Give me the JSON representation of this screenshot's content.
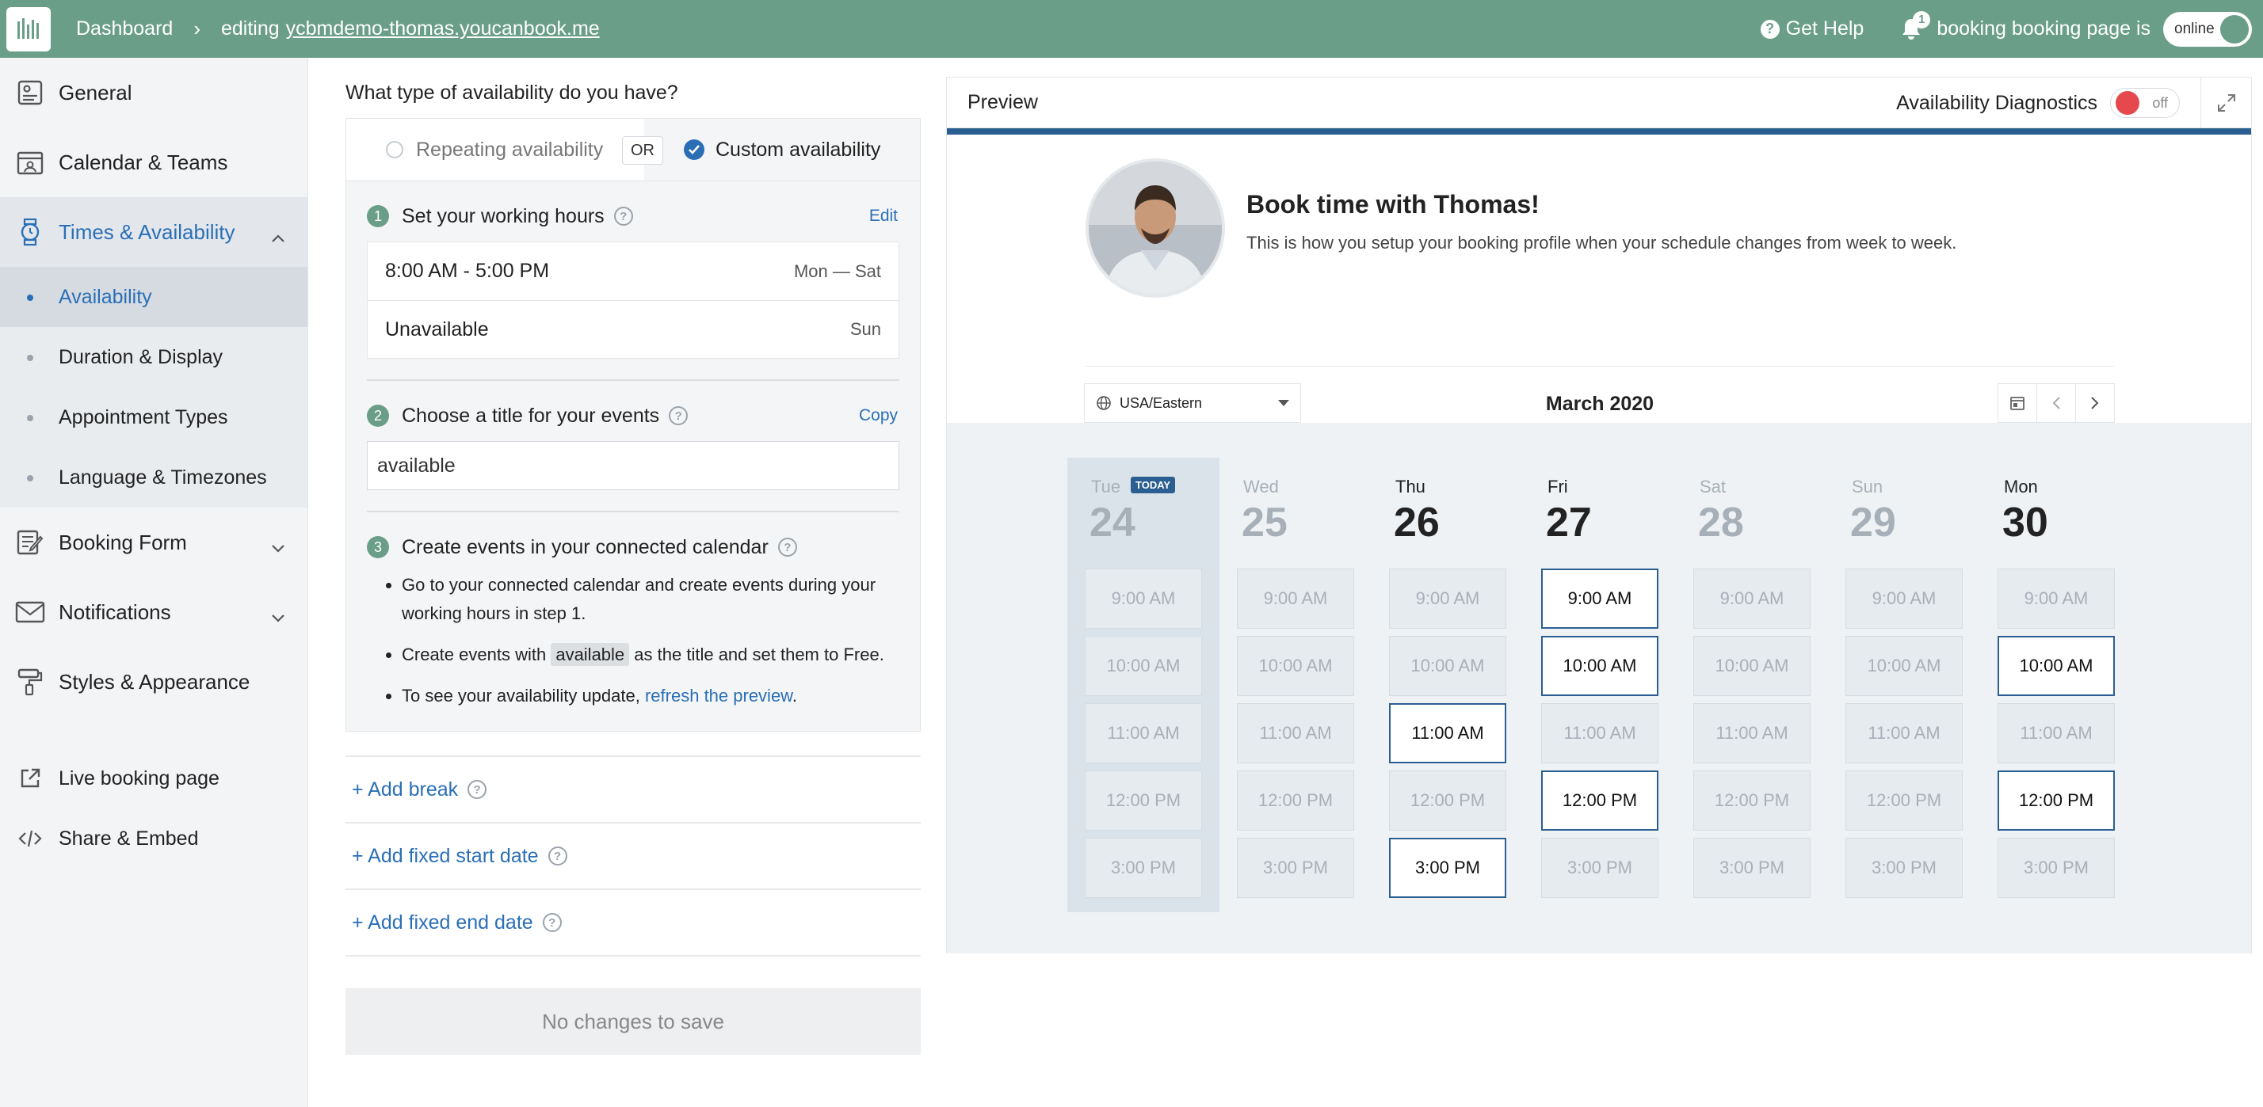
{
  "topbar": {
    "dashboard": "Dashboard",
    "editing_prefix": "editing",
    "editing_link": "ycbmdemo-thomas.youcanbook.me",
    "get_help": "Get Help",
    "notif_count": "1",
    "status_text": "booking booking page is",
    "online_label": "online"
  },
  "sidebar": {
    "general": "General",
    "calendar_teams": "Calendar & Teams",
    "times_availability": "Times & Availability",
    "sub": {
      "availability": "Availability",
      "duration_display": "Duration & Display",
      "appointment_types": "Appointment Types",
      "language_timezones": "Language & Timezones"
    },
    "booking_form": "Booking Form",
    "notifications": "Notifications",
    "styles_appearance": "Styles & Appearance",
    "live_booking_page": "Live booking page",
    "share_embed": "Share & Embed"
  },
  "availability": {
    "question": "What type of availability do you have?",
    "repeating": "Repeating availability",
    "or": "OR",
    "custom": "Custom availability",
    "step1": {
      "num": "1",
      "title": "Set your working hours",
      "action": "Edit",
      "rows": [
        {
          "hours": "8:00 AM - 5:00 PM",
          "days": "Mon — Sat"
        },
        {
          "hours": "Unavailable",
          "days": "Sun"
        }
      ]
    },
    "step2": {
      "num": "2",
      "title": "Choose a title for your events",
      "action": "Copy",
      "value": "available"
    },
    "step3": {
      "num": "3",
      "title": "Create events in your connected calendar",
      "b1": "Go to your connected calendar and create events during your working hours in step 1.",
      "b2_pre": "Create events with",
      "b2_kw": "available",
      "b2_mid": "as the title and set them to",
      "b2_free": "Free",
      "b2_end": ".",
      "b3_pre": "To see your availability update,",
      "b3_link": "refresh the preview",
      "b3_end": "."
    },
    "add_break": "+ Add break",
    "add_start": "+ Add fixed start date",
    "add_end": "+ Add fixed end date",
    "save": "No changes to save"
  },
  "preview": {
    "label": "Preview",
    "diagnostics": "Availability Diagnostics",
    "diag_state": "off",
    "book_title": "Book time with Thomas!",
    "book_sub": "This is how you setup your booking profile when your schedule changes from week to week.",
    "timezone": "USA/Eastern",
    "month": "March 2020",
    "today_label": "TODAY",
    "days": [
      {
        "dow": "Tue",
        "num": "24",
        "today": true,
        "off": true,
        "slots": [
          {
            "t": "9:00 AM",
            "on": false
          },
          {
            "t": "10:00 AM",
            "on": false
          },
          {
            "t": "11:00 AM",
            "on": false
          },
          {
            "t": "12:00 PM",
            "on": false
          },
          {
            "t": "3:00 PM",
            "on": false
          }
        ]
      },
      {
        "dow": "Wed",
        "num": "25",
        "off": true,
        "slots": [
          {
            "t": "9:00 AM",
            "on": false
          },
          {
            "t": "10:00 AM",
            "on": false
          },
          {
            "t": "11:00 AM",
            "on": false
          },
          {
            "t": "12:00 PM",
            "on": false
          },
          {
            "t": "3:00 PM",
            "on": false
          }
        ]
      },
      {
        "dow": "Thu",
        "num": "26",
        "off": false,
        "slots": [
          {
            "t": "9:00 AM",
            "on": false
          },
          {
            "t": "10:00 AM",
            "on": false
          },
          {
            "t": "11:00 AM",
            "on": true
          },
          {
            "t": "12:00 PM",
            "on": false
          },
          {
            "t": "3:00 PM",
            "on": true
          }
        ]
      },
      {
        "dow": "Fri",
        "num": "27",
        "off": false,
        "slots": [
          {
            "t": "9:00 AM",
            "on": true
          },
          {
            "t": "10:00 AM",
            "on": true
          },
          {
            "t": "11:00 AM",
            "on": false
          },
          {
            "t": "12:00 PM",
            "on": true
          },
          {
            "t": "3:00 PM",
            "on": false
          }
        ]
      },
      {
        "dow": "Sat",
        "num": "28",
        "off": true,
        "slots": [
          {
            "t": "9:00 AM",
            "on": false
          },
          {
            "t": "10:00 AM",
            "on": false
          },
          {
            "t": "11:00 AM",
            "on": false
          },
          {
            "t": "12:00 PM",
            "on": false
          },
          {
            "t": "3:00 PM",
            "on": false
          }
        ]
      },
      {
        "dow": "Sun",
        "num": "29",
        "off": true,
        "slots": [
          {
            "t": "9:00 AM",
            "on": false
          },
          {
            "t": "10:00 AM",
            "on": false
          },
          {
            "t": "11:00 AM",
            "on": false
          },
          {
            "t": "12:00 PM",
            "on": false
          },
          {
            "t": "3:00 PM",
            "on": false
          }
        ]
      },
      {
        "dow": "Mon",
        "num": "30",
        "off": false,
        "slots": [
          {
            "t": "9:00 AM",
            "on": false
          },
          {
            "t": "10:00 AM",
            "on": true
          },
          {
            "t": "11:00 AM",
            "on": false
          },
          {
            "t": "12:00 PM",
            "on": true
          },
          {
            "t": "3:00 PM",
            "on": false
          }
        ]
      }
    ]
  },
  "colors": {
    "topbar": "#6a9e89",
    "accent": "#2a6fb6",
    "preview_accent": "#2c5f91"
  }
}
